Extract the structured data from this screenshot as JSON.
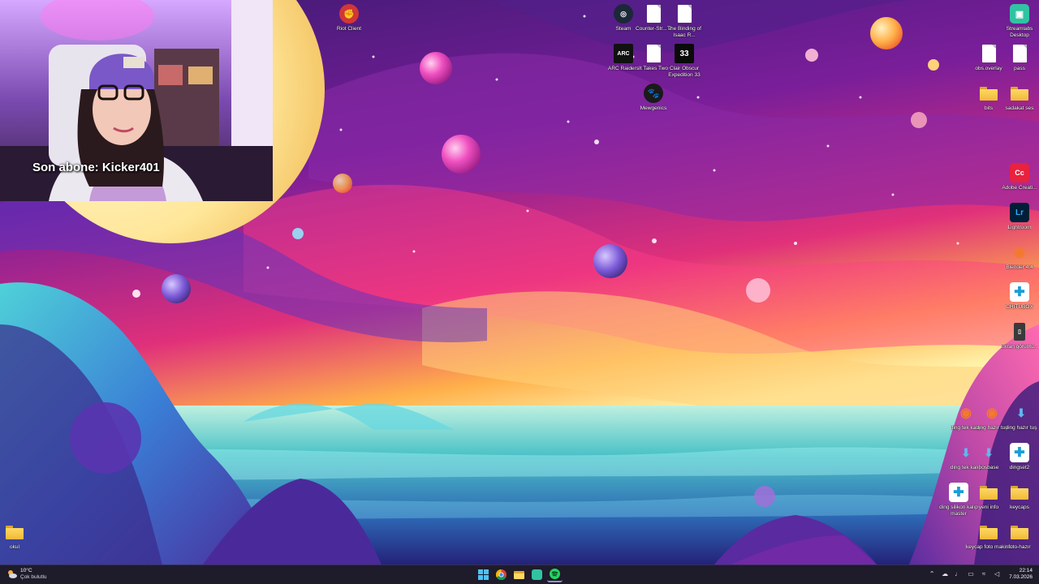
{
  "webcam": {
    "caption": "Son abone: Kicker401"
  },
  "desktop_icons": {
    "riot_client": "Riot Client",
    "steam": "Steam",
    "counter_strike": "Counter-Str... 2",
    "binding_of_isaac": "The Binding of Isaac R...",
    "arc_raiders": "ARC Raiders",
    "it_takes_two": "It Takes Two",
    "clair_obscur": "Clair Obscur Expedition 33",
    "mewgenics": "Mewgenics",
    "streamlabs": "Streamlabs Desktop",
    "obs_overlay": "obs.overlay",
    "pass": "pass",
    "bits": "bits",
    "sadakat_ses": "sadakat ses",
    "adobe_creative": "Adobe Creati...",
    "lightroom": "Lightroom",
    "blender": "Blender 4.4",
    "chitubox": "CHITUBOX",
    "ekran_goruntu": "Ekran görüntü...",
    "ding_tek_kalip_1": "ding tek kalıp",
    "ding_hazir_tus_1": "ding hazır tuş",
    "ding_hazir_tus_2": "ding hazır tuş",
    "ding_tek_kalip_2": "ding tek kalıp",
    "bosbase": "bosbase",
    "dingset2": "dingset2",
    "ding_silikon": "ding silikon kalıp master",
    "yeni_info": "yeni info",
    "keycaps": "keycaps",
    "keycap_foto": "keycap foto makina",
    "foto_hazir": "foto-hazır",
    "okul": "okul"
  },
  "taskbar": {
    "weather_temp": "10°C",
    "weather_condition": "Çok bulutlu",
    "time": "22:14",
    "date": "7.03.2026"
  },
  "colors": {
    "taskbar_bg": "#1e1b2a",
    "folder": "#ffd861",
    "spotify": "#1ed760",
    "riot": "#d13639"
  }
}
